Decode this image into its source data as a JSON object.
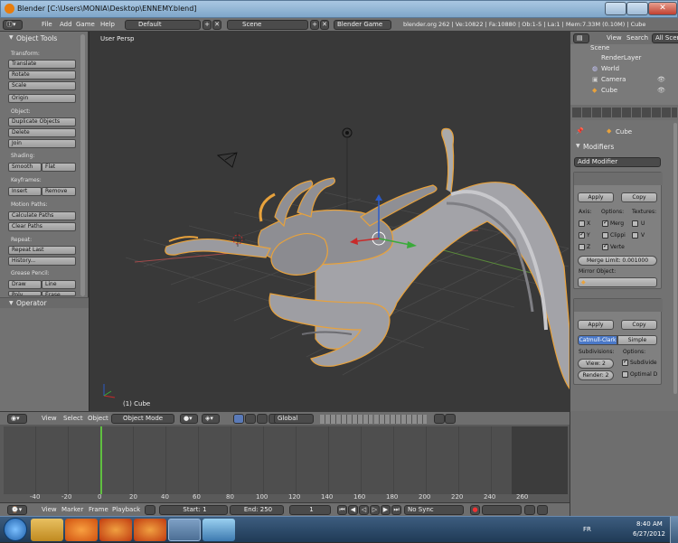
{
  "window": {
    "title": "Blender [C:\\Users\\MONIA\\Desktop\\ENNEMY.blend]"
  },
  "top_header": {
    "menus": [
      "File",
      "Add",
      "Game",
      "Help"
    ],
    "screen_layout": "Default",
    "scene": "Scene",
    "engine": "Blender Game",
    "stats": "blender.org 262 | Ve:10822 | Fa:10880 | Ob:1-5 | La:1 | Mem:7.33M (0.10M) | Cube"
  },
  "tool_shelf": {
    "header": "Object Tools",
    "sections": [
      {
        "label": "Transform:",
        "buttons": [
          "Translate",
          "Rotate",
          "Scale"
        ]
      },
      {
        "label": "",
        "buttons": [
          "Origin"
        ]
      },
      {
        "label": "Object:",
        "buttons": [
          "Duplicate Objects",
          "Delete",
          "Join"
        ]
      },
      {
        "label": "Shading:",
        "buttons": [
          "Smooth",
          "Flat"
        ]
      },
      {
        "label": "Keyframes:",
        "buttons": [
          "Insert",
          "Remove"
        ]
      },
      {
        "label": "Motion Paths:",
        "buttons": [
          "Calculate Paths",
          "Clear Paths"
        ]
      },
      {
        "label": "Repeat:",
        "buttons": [
          "Repeat Last",
          "History..."
        ]
      },
      {
        "label": "Grease Pencil:",
        "buttons": [
          "Draw",
          "Line",
          "Poly",
          "Erase"
        ]
      }
    ],
    "operator_header": "Operator"
  },
  "viewport": {
    "view_label": "User Persp",
    "object_label": "(1) Cube"
  },
  "viewport_header": {
    "menus": [
      "View",
      "Select",
      "Object"
    ],
    "mode": "Object Mode",
    "orientation": "Global"
  },
  "timeline": {
    "ticks": [
      "-40",
      "-20",
      "0",
      "20",
      "40",
      "60",
      "80",
      "100",
      "120",
      "140",
      "160",
      "180",
      "200",
      "220",
      "240",
      "260"
    ],
    "current_frame": 1,
    "menus": [
      "View",
      "Marker",
      "Frame",
      "Playback"
    ],
    "start": "Start: 1",
    "end": "End: 250",
    "frame": "1",
    "sync": "No Sync"
  },
  "outliner": {
    "menus": [
      "View",
      "Search",
      "All Scen"
    ],
    "items": [
      "Scene",
      "RenderLayer",
      "World",
      "Camera",
      "Cube"
    ]
  },
  "properties": {
    "object_name": "Cube",
    "modifiers_header": "Modifiers",
    "add_modifier": "Add Modifier",
    "mirror": {
      "apply": "Apply",
      "copy": "Copy",
      "axis_label": "Axis:",
      "options_label": "Options:",
      "textures_label": "Textures:",
      "axes": [
        {
          "label": "X",
          "on": false
        },
        {
          "label": "Y",
          "on": true
        },
        {
          "label": "Z",
          "on": false
        }
      ],
      "options": [
        {
          "label": "Merg",
          "on": true
        },
        {
          "label": "Clippi",
          "on": false
        },
        {
          "label": "Verte",
          "on": true
        }
      ],
      "textures": [
        {
          "label": "U",
          "on": false
        },
        {
          "label": "V",
          "on": false
        }
      ],
      "merge_limit": "Merge Limit: 0.001000",
      "mirror_object_label": "Mirror Object:"
    },
    "subsurf": {
      "apply": "Apply",
      "copy": "Copy",
      "tab_catmull": "Catmull-Clark",
      "tab_simple": "Simple",
      "subdivisions_label": "Subdivisions:",
      "options_label": "Options:",
      "view": "View: 2",
      "render": "Render: 2",
      "subdivide_uvs": "Subdivide",
      "optimal": "Optimal D"
    }
  },
  "taskbar": {
    "lang": "FR",
    "time": "8:40 AM",
    "date": "6/27/2012"
  },
  "colors": {
    "selection_outline": "#e8a23c",
    "mesh": "#9a9a9f",
    "accent_blue": "#4a78c8"
  }
}
